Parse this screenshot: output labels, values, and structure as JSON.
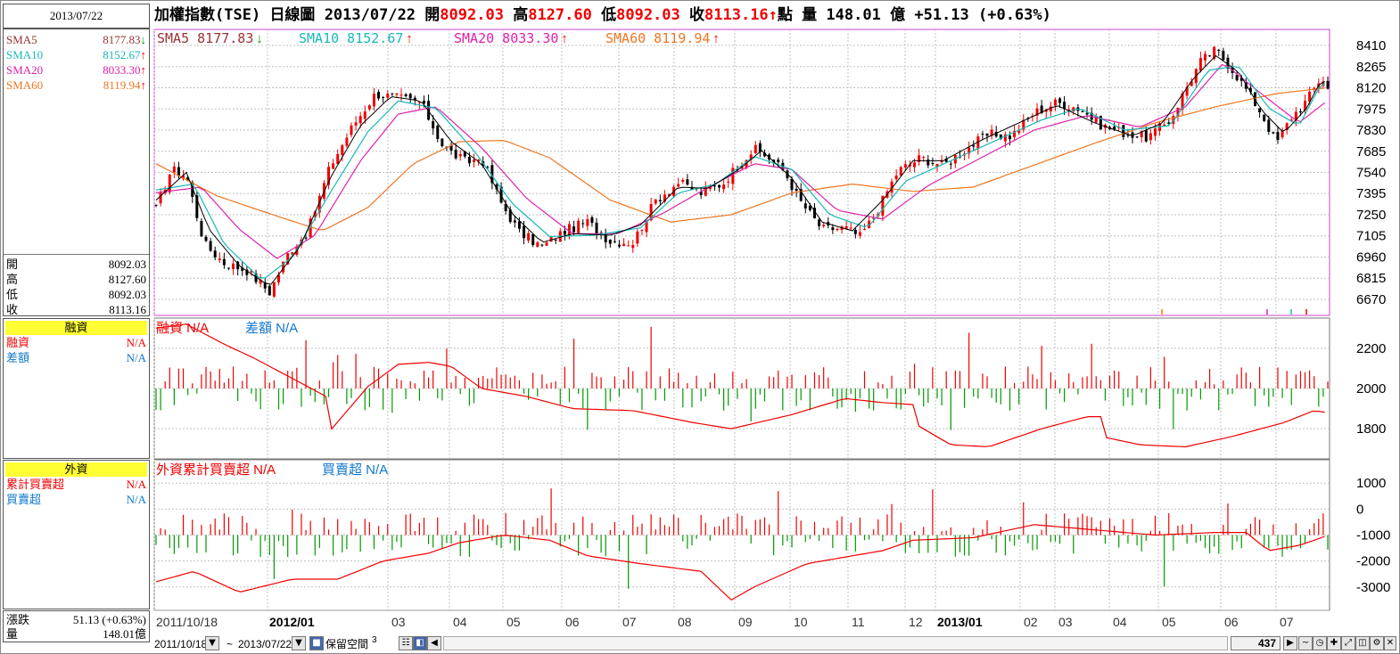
{
  "left_panel": {
    "date": "2013/07/22",
    "sma": [
      {
        "label": "SMA5",
        "value": "8177.83",
        "arrow": "down",
        "color": "#993333"
      },
      {
        "label": "SMA10",
        "value": "8152.67",
        "arrow": "up",
        "color": "#19b8b8"
      },
      {
        "label": "SMA20",
        "value": "8033.30",
        "arrow": "up",
        "color": "#dd22aa"
      },
      {
        "label": "SMA60",
        "value": "8119.94",
        "arrow": "up",
        "color": "#ee7722"
      }
    ],
    "ohlc": [
      {
        "label": "開",
        "value": "8092.03"
      },
      {
        "label": "高",
        "value": "8127.60"
      },
      {
        "label": "低",
        "value": "8092.03"
      },
      {
        "label": "收",
        "value": "8113.16"
      }
    ],
    "margin_title": "融資",
    "margin": [
      {
        "label": "融資",
        "value": "N/A",
        "color": "#ee0000"
      },
      {
        "label": "差額",
        "value": "N/A",
        "color": "#1177cc"
      }
    ],
    "foreign_title": "外資",
    "foreign": [
      {
        "label": "累計買賣超",
        "value": "N/A",
        "color": "#ee0000"
      },
      {
        "label": "買賣超",
        "value": "N/A",
        "color": "#1177cc"
      }
    ],
    "change_label": "漲跌",
    "change_value": "51.13 (+0.63%)",
    "volume_label": "量",
    "volume_value": "148.01億"
  },
  "header": {
    "name": "加權指數(TSE)",
    "chart_kind": "日線圖",
    "date": "2013/07/22",
    "open_label": "開",
    "open": "8092.03",
    "high_label": "高",
    "high": "8127.60",
    "low_label": "低",
    "low": "8092.03",
    "close_label": "收",
    "close": "8113.16",
    "arrow": "↑",
    "point_label": "點",
    "volume_label": "量",
    "volume": "148.01",
    "volume_unit": "億",
    "change": "+51.13 (+0.63%)"
  },
  "colors": {
    "up": "#ee0000",
    "down": "#009900",
    "sma5": "#993333",
    "sma10": "#19b8b8",
    "sma20": "#dd22aa",
    "sma60": "#ee7722",
    "grid": "#c0c0c0",
    "border": "#cc44cc",
    "blue": "#1177cc"
  },
  "bottom_bar": {
    "start_date": "2011/10/18",
    "tilde": "~",
    "end_date": "2013/07/22",
    "reserve_label": "保留空間",
    "reserve_value": "3",
    "count": "437"
  },
  "chart_data": [
    {
      "type": "candlestick",
      "legend": [
        {
          "name": "SMA5",
          "value": "8177.83",
          "arrow": "down"
        },
        {
          "name": "SMA10",
          "value": "8152.67",
          "arrow": "up"
        },
        {
          "name": "SMA20",
          "value": "8033.30",
          "arrow": "up"
        },
        {
          "name": "SMA60",
          "value": "8119.94",
          "arrow": "up"
        }
      ],
      "y_ticks": [
        8410,
        8265,
        8120,
        7975,
        7830,
        7685,
        7540,
        7395,
        7250,
        7105,
        6960,
        6815,
        6670
      ],
      "ylim": [
        6560,
        8520
      ],
      "x_ticks": [
        "2011/10/18",
        "2012/01",
        "03",
        "04",
        "05",
        "06",
        "07",
        "08",
        "09",
        "10",
        "11",
        "12",
        "2013/01",
        "02",
        "03",
        "04",
        "05",
        "06",
        "07"
      ],
      "close_path": [
        [
          0,
          7290
        ],
        [
          10,
          7560
        ],
        [
          20,
          7520
        ],
        [
          32,
          7050
        ],
        [
          45,
          6920
        ],
        [
          60,
          6870
        ],
        [
          75,
          6720
        ],
        [
          88,
          7000
        ],
        [
          100,
          7130
        ],
        [
          115,
          7580
        ],
        [
          130,
          7860
        ],
        [
          145,
          8080
        ],
        [
          160,
          8050
        ],
        [
          175,
          8020
        ],
        [
          190,
          7710
        ],
        [
          205,
          7610
        ],
        [
          215,
          7640
        ],
        [
          228,
          7330
        ],
        [
          240,
          7130
        ],
        [
          255,
          7030
        ],
        [
          270,
          7140
        ],
        [
          285,
          7200
        ],
        [
          300,
          7070
        ],
        [
          315,
          7060
        ],
        [
          330,
          7350
        ],
        [
          345,
          7470
        ],
        [
          360,
          7400
        ],
        [
          375,
          7470
        ],
        [
          385,
          7600
        ],
        [
          395,
          7700
        ],
        [
          405,
          7640
        ],
        [
          415,
          7550
        ],
        [
          425,
          7350
        ],
        [
          440,
          7150
        ],
        [
          455,
          7160
        ],
        [
          465,
          7100
        ],
        [
          475,
          7250
        ],
        [
          490,
          7550
        ],
        [
          505,
          7640
        ],
        [
          520,
          7590
        ],
        [
          535,
          7700
        ],
        [
          550,
          7800
        ],
        [
          565,
          7790
        ],
        [
          580,
          7950
        ],
        [
          595,
          8020
        ],
        [
          610,
          7980
        ],
        [
          625,
          7860
        ],
        [
          640,
          7810
        ],
        [
          655,
          7780
        ],
        [
          670,
          7900
        ],
        [
          680,
          8110
        ],
        [
          690,
          8300
        ],
        [
          700,
          8380
        ],
        [
          710,
          8260
        ],
        [
          720,
          8110
        ],
        [
          730,
          7950
        ],
        [
          740,
          7740
        ],
        [
          750,
          7920
        ],
        [
          760,
          8030
        ],
        [
          770,
          8200
        ],
        [
          774,
          8113
        ]
      ],
      "sma5_path": [
        [
          0,
          7350
        ],
        [
          20,
          7540
        ],
        [
          35,
          7150
        ],
        [
          55,
          6900
        ],
        [
          75,
          6760
        ],
        [
          95,
          7030
        ],
        [
          115,
          7500
        ],
        [
          135,
          7860
        ],
        [
          155,
          8060
        ],
        [
          175,
          8030
        ],
        [
          195,
          7750
        ],
        [
          215,
          7600
        ],
        [
          235,
          7260
        ],
        [
          255,
          7060
        ],
        [
          275,
          7120
        ],
        [
          300,
          7110
        ],
        [
          320,
          7180
        ],
        [
          345,
          7440
        ],
        [
          365,
          7430
        ],
        [
          385,
          7560
        ],
        [
          400,
          7690
        ],
        [
          420,
          7500
        ],
        [
          440,
          7200
        ],
        [
          460,
          7140
        ],
        [
          480,
          7350
        ],
        [
          500,
          7620
        ],
        [
          520,
          7620
        ],
        [
          545,
          7760
        ],
        [
          570,
          7880
        ],
        [
          595,
          8000
        ],
        [
          620,
          7880
        ],
        [
          645,
          7790
        ],
        [
          665,
          7880
        ],
        [
          685,
          8180
        ],
        [
          700,
          8340
        ],
        [
          715,
          8230
        ],
        [
          730,
          7970
        ],
        [
          745,
          7810
        ],
        [
          760,
          7980
        ],
        [
          770,
          8178
        ],
        [
          774,
          8150
        ]
      ],
      "sma10_path": [
        [
          0,
          7420
        ],
        [
          25,
          7460
        ],
        [
          45,
          7050
        ],
        [
          70,
          6800
        ],
        [
          90,
          6960
        ],
        [
          115,
          7400
        ],
        [
          140,
          7820
        ],
        [
          160,
          8030
        ],
        [
          185,
          7980
        ],
        [
          210,
          7690
        ],
        [
          235,
          7330
        ],
        [
          260,
          7100
        ],
        [
          290,
          7110
        ],
        [
          320,
          7160
        ],
        [
          345,
          7400
        ],
        [
          370,
          7460
        ],
        [
          395,
          7650
        ],
        [
          420,
          7560
        ],
        [
          445,
          7250
        ],
        [
          470,
          7160
        ],
        [
          495,
          7480
        ],
        [
          525,
          7620
        ],
        [
          555,
          7760
        ],
        [
          585,
          7900
        ],
        [
          610,
          7980
        ],
        [
          640,
          7830
        ],
        [
          670,
          7860
        ],
        [
          695,
          8240
        ],
        [
          715,
          8270
        ],
        [
          735,
          7980
        ],
        [
          755,
          7860
        ],
        [
          770,
          8153
        ],
        [
          774,
          8150
        ]
      ],
      "sma20_path": [
        [
          0,
          7400
        ],
        [
          30,
          7440
        ],
        [
          55,
          7150
        ],
        [
          80,
          6950
        ],
        [
          105,
          7110
        ],
        [
          135,
          7620
        ],
        [
          160,
          7940
        ],
        [
          185,
          7990
        ],
        [
          215,
          7710
        ],
        [
          245,
          7360
        ],
        [
          275,
          7120
        ],
        [
          305,
          7120
        ],
        [
          335,
          7260
        ],
        [
          365,
          7440
        ],
        [
          395,
          7600
        ],
        [
          420,
          7560
        ],
        [
          450,
          7280
        ],
        [
          480,
          7220
        ],
        [
          510,
          7450
        ],
        [
          545,
          7640
        ],
        [
          580,
          7830
        ],
        [
          615,
          7930
        ],
        [
          650,
          7850
        ],
        [
          680,
          7990
        ],
        [
          705,
          8290
        ],
        [
          730,
          8080
        ],
        [
          755,
          7880
        ],
        [
          774,
          8033
        ]
      ],
      "sma60_path": [
        [
          0,
          7600
        ],
        [
          40,
          7380
        ],
        [
          80,
          7240
        ],
        [
          110,
          7140
        ],
        [
          140,
          7300
        ],
        [
          170,
          7600
        ],
        [
          200,
          7750
        ],
        [
          230,
          7760
        ],
        [
          260,
          7640
        ],
        [
          300,
          7350
        ],
        [
          340,
          7200
        ],
        [
          380,
          7250
        ],
        [
          420,
          7400
        ],
        [
          460,
          7460
        ],
        [
          500,
          7410
        ],
        [
          540,
          7440
        ],
        [
          580,
          7590
        ],
        [
          620,
          7740
        ],
        [
          660,
          7880
        ],
        [
          700,
          7990
        ],
        [
          740,
          8080
        ],
        [
          774,
          8120
        ]
      ]
    },
    {
      "type": "bar+line",
      "legend": [
        {
          "name": "融資",
          "value": "N/A"
        },
        {
          "name": "差額",
          "value": "N/A"
        }
      ],
      "y_ticks": [
        2200,
        2000,
        1800
      ],
      "ylim": [
        1650,
        2350
      ],
      "baseline": 2000,
      "line_path": [
        [
          0,
          2300
        ],
        [
          20,
          2320
        ],
        [
          45,
          2220
        ],
        [
          65,
          2150
        ],
        [
          95,
          2030
        ],
        [
          115,
          1950
        ],
        [
          115,
          1790
        ],
        [
          140,
          2010
        ],
        [
          160,
          2120
        ],
        [
          180,
          2130
        ],
        [
          195,
          2110
        ],
        [
          215,
          2000
        ],
        [
          245,
          1960
        ],
        [
          275,
          1900
        ],
        [
          315,
          1890
        ],
        [
          355,
          1830
        ],
        [
          380,
          1800
        ],
        [
          420,
          1870
        ],
        [
          455,
          1950
        ],
        [
          480,
          1930
        ],
        [
          500,
          1920
        ],
        [
          500,
          1830
        ],
        [
          525,
          1720
        ],
        [
          550,
          1710
        ],
        [
          585,
          1800
        ],
        [
          615,
          1860
        ],
        [
          625,
          1860
        ],
        [
          625,
          1760
        ],
        [
          650,
          1720
        ],
        [
          680,
          1710
        ],
        [
          710,
          1760
        ],
        [
          745,
          1830
        ],
        [
          765,
          1890
        ],
        [
          774,
          1880
        ]
      ]
    },
    {
      "type": "bar+line",
      "legend": [
        {
          "name": "外資累計買賣超",
          "value": "N/A"
        },
        {
          "name": "買賣超",
          "value": "N/A"
        }
      ],
      "y_ticks": [
        1000,
        0,
        -1000,
        -2000,
        -3000
      ],
      "ylim": [
        -3900,
        1900
      ],
      "baseline": -1000,
      "line_path": [
        [
          0,
          -2800
        ],
        [
          25,
          -2400
        ],
        [
          55,
          -3200
        ],
        [
          90,
          -2700
        ],
        [
          120,
          -2700
        ],
        [
          150,
          -2000
        ],
        [
          180,
          -1700
        ],
        [
          200,
          -1300
        ],
        [
          230,
          -1000
        ],
        [
          260,
          -1200
        ],
        [
          285,
          -1800
        ],
        [
          320,
          -2100
        ],
        [
          360,
          -2400
        ],
        [
          380,
          -3500
        ],
        [
          395,
          -3000
        ],
        [
          430,
          -2100
        ],
        [
          480,
          -1600
        ],
        [
          500,
          -1200
        ],
        [
          540,
          -1100
        ],
        [
          580,
          -600
        ],
        [
          620,
          -800
        ],
        [
          660,
          -1000
        ],
        [
          700,
          -900
        ],
        [
          720,
          -900
        ],
        [
          735,
          -1600
        ],
        [
          755,
          -1400
        ],
        [
          770,
          -1100
        ],
        [
          774,
          -1000
        ]
      ]
    }
  ]
}
